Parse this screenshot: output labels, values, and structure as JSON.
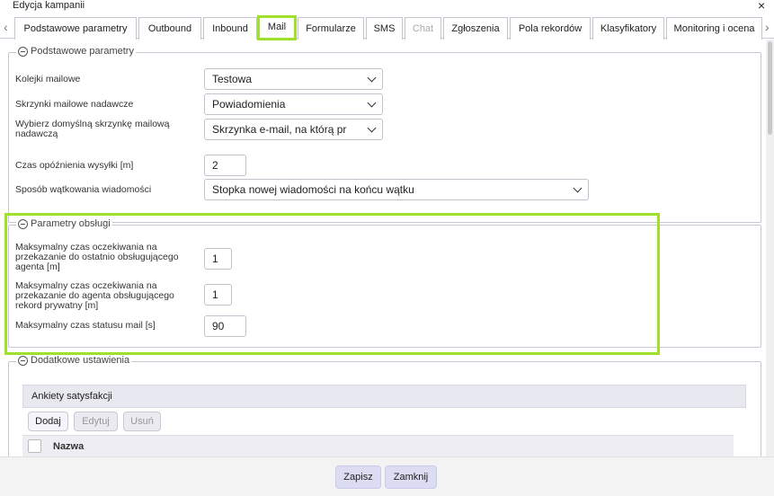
{
  "window": {
    "title": "Edycja kampanii",
    "close_symbol": "×"
  },
  "tabs": [
    {
      "label": "Podstawowe parametry"
    },
    {
      "label": "Outbound"
    },
    {
      "label": "Inbound"
    },
    {
      "label": "Mail",
      "active": true
    },
    {
      "label": "Formularze"
    },
    {
      "label": "SMS"
    },
    {
      "label": "Chat",
      "disabled": true
    },
    {
      "label": "Zgłoszenia"
    },
    {
      "label": "Pola rekordów"
    },
    {
      "label": "Klasyfikatory"
    },
    {
      "label": "Monitoring i ocena"
    }
  ],
  "tab_nav": {
    "prev": "‹",
    "next": "›"
  },
  "basic": {
    "legend": "Podstawowe parametry",
    "queue_label": "Kolejki mailowe",
    "queue_value": "Testowa",
    "sender_label": "Skrzynki mailowe nadawcze",
    "sender_value": "Powiadomienia",
    "default_label": "Wybierz domyślną skrzynkę mailową nadawczą",
    "default_value": "Skrzynka e-mail,  na którą pr",
    "delay_label": "Czas opóźnienia wysyłki [m]",
    "delay_value": "2",
    "thread_label": "Sposób wątkowania wiadomości",
    "thread_value": "Stopka nowej wiadomości na końcu wątku"
  },
  "handling": {
    "legend": "Parametry obsługi",
    "last_agent_label": "Maksymalny czas oczekiwania na przekazanie do ostatnio obsługującego agenta [m]",
    "last_agent_value": "1",
    "private_label": "Maksymalny czas oczekiwania na przekazanie do agenta obsługującego rekord prywatny [m]",
    "private_value": "1",
    "status_label": "Maksymalny czas statusu mail [s]",
    "status_value": "90"
  },
  "additional": {
    "legend": "Dodatkowe ustawienia",
    "surveys_header": "Ankiety satysfakcji",
    "add": "Dodaj",
    "edit": "Edytuj",
    "remove": "Usuń",
    "col_name": "Nazwa"
  },
  "footer": {
    "save": "Zapisz",
    "close": "Zamknij"
  },
  "colors": {
    "highlight": "#9ee02a",
    "footer_button": "#dcdcf2"
  }
}
